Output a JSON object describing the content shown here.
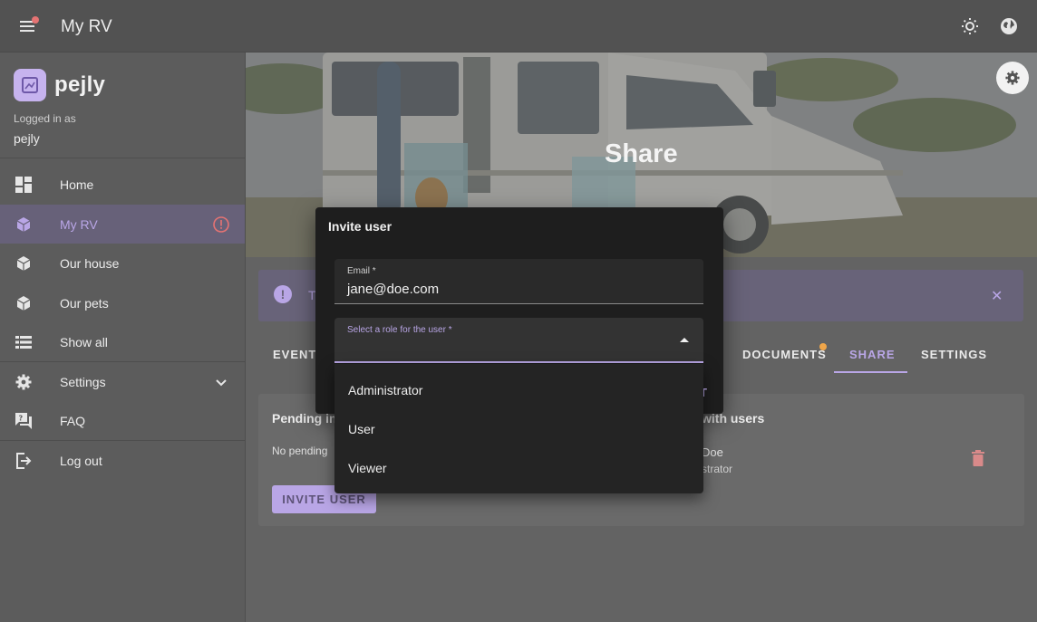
{
  "appbar": {
    "title": "My RV"
  },
  "sidebar": {
    "brand": "pejly",
    "logged_in_label": "Logged in as",
    "logged_in_user": "pejly",
    "items": [
      {
        "label": "Home",
        "icon": "dashboard-icon"
      },
      {
        "label": "My RV",
        "icon": "cube-icon",
        "active": true,
        "alert": true
      },
      {
        "label": "Our house",
        "icon": "cube-icon"
      },
      {
        "label": "Our pets",
        "icon": "cube-icon"
      },
      {
        "label": "Show all",
        "icon": "list-icon"
      },
      {
        "label": "Settings",
        "icon": "gear-icon",
        "expandable": true
      },
      {
        "label": "FAQ",
        "icon": "faq-icon"
      },
      {
        "label": "Log out",
        "icon": "logout-icon"
      }
    ]
  },
  "hero": {
    "title": "Share"
  },
  "alert": {
    "text_visible": "T"
  },
  "tabs": {
    "events_fragment": "EVENTS",
    "documents": "DOCUMENTS",
    "share": "SHARE",
    "settings": "SETTINGS"
  },
  "card": {
    "pending_heading_fragment": "Pending in",
    "pending_text_fragment": "No pending",
    "shared_heading_fragment": "with users",
    "user_name_fragment": "Doe",
    "user_role_fragment": "strator",
    "invite_button": "INVITE USER"
  },
  "dialog": {
    "title": "Invite user",
    "email_label": "Email *",
    "email_value": "jane@doe.com",
    "role_label": "Select a role for the user *",
    "role_value": "",
    "hidden_button_fragment": "T",
    "role_options": [
      "Administrator",
      "User",
      "Viewer"
    ]
  },
  "colors": {
    "accent": "#b9a6e6",
    "notification": "#f0a64a",
    "danger": "#e57373"
  }
}
